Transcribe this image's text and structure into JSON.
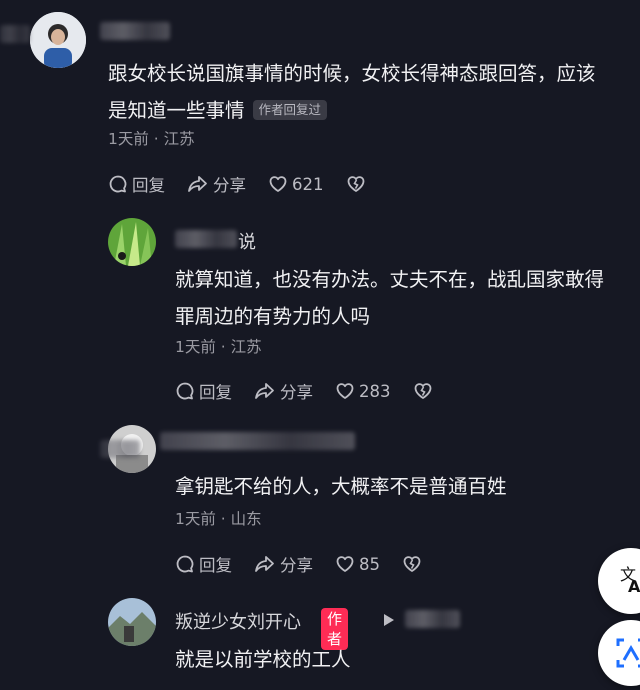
{
  "comments": [
    {
      "text_line1": "跟女校长说国旗事情的时候，女校长得神态跟回答，应该",
      "text_line2": "是知道一些事情",
      "badge": "作者回复过",
      "meta": "1天前 · 江苏",
      "reply_label": "回复",
      "share_label": "分享",
      "like_count": "621"
    },
    {
      "name_partial": "说",
      "text_line1": "就算知道，也没有办法。丈夫不在，战乱国家敢得",
      "text_line2": "罪周边的有势力的人吗",
      "meta": "1天前 · 江苏",
      "reply_label": "回复",
      "share_label": "分享",
      "like_count": "283"
    },
    {
      "text_line1": "拿钥匙不给的人，大概率不是普通百姓",
      "meta": "1天前 · 山东",
      "reply_label": "回复",
      "share_label": "分享",
      "like_count": "85"
    },
    {
      "name": "叛逆少女刘开心",
      "author_badge": "作者",
      "text_line1": "就是以前学校的工人"
    }
  ],
  "colors": {
    "background": "#161823",
    "author_badge": "#fe2c55"
  },
  "icons": [
    "comment-bubble-icon",
    "share-arrow-icon",
    "heart-icon",
    "broken-heart-icon",
    "translate-icon",
    "scan-icon",
    "play-triangle-icon"
  ]
}
